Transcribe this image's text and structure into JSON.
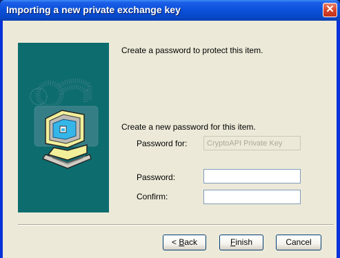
{
  "window": {
    "title": "Importing a new private exchange key",
    "close_glyph": "✕"
  },
  "content": {
    "intro": "Create a password to protect this item.",
    "section_heading": "Create a new password for this item.",
    "password_for_label": "Password for:",
    "password_for_value": "CryptoAPI Private Key",
    "password_label": "Password:",
    "password_value": "",
    "confirm_label": "Confirm:",
    "confirm_value": ""
  },
  "buttons": {
    "back_prefix": "< ",
    "back_mnemonic": "B",
    "back_rest": "ack",
    "finish_mnemonic": "F",
    "finish_rest": "inish",
    "cancel": "Cancel"
  },
  "icons": {
    "illustration": "computer-with-padlock-icon",
    "close": "close-icon"
  },
  "colors": {
    "titlebar": "#0a50d8",
    "side_panel": "#0d6c6e",
    "dialog_face": "#ece9d8",
    "close_button": "#d9442a"
  }
}
